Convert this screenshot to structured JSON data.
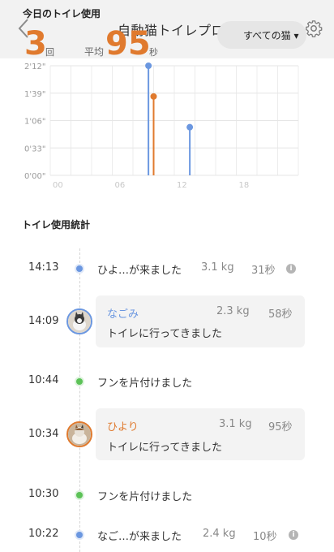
{
  "header": {
    "today_label": "今日のトイレ使用",
    "title": "自動猫トイレプロ",
    "count": "3",
    "count_unit": "回",
    "avg_label": "平均",
    "avg_value": "95",
    "avg_unit": "秒",
    "cat_filter": "すべての猫 ▾",
    "icons": {
      "back": "chevron-left-icon",
      "settings": "gear-icon"
    }
  },
  "chart_data": {
    "type": "bar",
    "y_ticks": [
      "2'12\"",
      "1'39\"",
      "1'06\"",
      "0'33\"",
      "0'00\""
    ],
    "x_ticks": [
      "00",
      "06",
      "12",
      "18"
    ],
    "ylim_seconds": [
      0,
      132
    ],
    "xlim_hours": [
      0,
      24
    ],
    "grid": true,
    "series": [
      {
        "color": "#6b97e0",
        "points": [
          {
            "hour": 9.5,
            "seconds": 132
          },
          {
            "hour": 13.5,
            "seconds": 58
          }
        ]
      },
      {
        "color": "#e07a2e",
        "points": [
          {
            "hour": 10.0,
            "seconds": 95
          }
        ]
      }
    ]
  },
  "stats": {
    "title": "トイレ使用統計",
    "events": [
      {
        "time": "14:13",
        "text": "ひよ…が来ました",
        "weight": "3.1 kg",
        "duration": "31秒"
      },
      {
        "time": "14:09",
        "name": "なごみ",
        "weight": "2.3 kg",
        "duration": "58秒",
        "text": "トイレに行ってきました"
      },
      {
        "time": "10:44",
        "text": "フンを片付けました"
      },
      {
        "time": "10:34",
        "name": "ひより",
        "weight": "3.1 kg",
        "duration": "95秒",
        "text": "トイレに行ってきました"
      },
      {
        "time": "10:30",
        "text": "フンを片付けました"
      },
      {
        "time": "10:22",
        "text": "なご…が来ました",
        "weight": "2.4 kg",
        "duration": "10秒"
      }
    ]
  },
  "colors": {
    "accent": "#e07a2e",
    "blue": "#6b97e0",
    "green": "#5cc257"
  }
}
